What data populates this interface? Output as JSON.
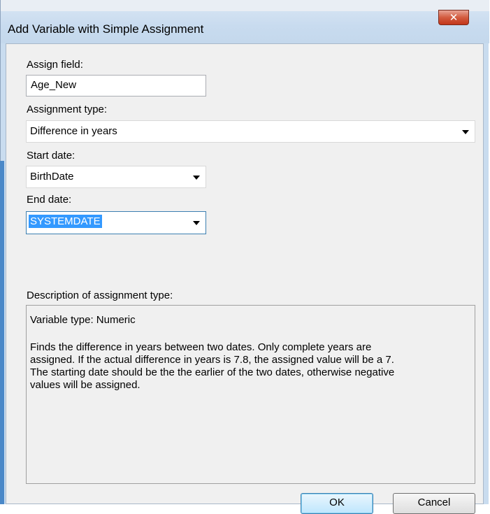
{
  "window": {
    "title": "Add Variable with Simple Assignment",
    "close_icon": "✕"
  },
  "assign_field": {
    "label": "Assign field:",
    "value": "Age_New"
  },
  "assignment_type": {
    "label": "Assignment type:",
    "value": "Difference in years"
  },
  "start_date": {
    "label": "Start date:",
    "value": "BirthDate"
  },
  "end_date": {
    "label": "End date:",
    "value": "SYSTEMDATE"
  },
  "description": {
    "label": "Description of assignment type:",
    "variable_type": "Variable type: Numeric",
    "lines": [
      "Finds the difference in years between two dates. Only complete years are",
      "assigned. If the actual difference in years is 7.8, the assigned value will be a 7.",
      "The starting date should be the the earlier of the two dates, otherwise negative",
      "values will be assigned."
    ]
  },
  "buttons": {
    "ok": "OK",
    "cancel": "Cancel"
  },
  "colors": {
    "selection": "#3399ff",
    "close_button": "#c2361b",
    "frame": "#c9dcef"
  }
}
